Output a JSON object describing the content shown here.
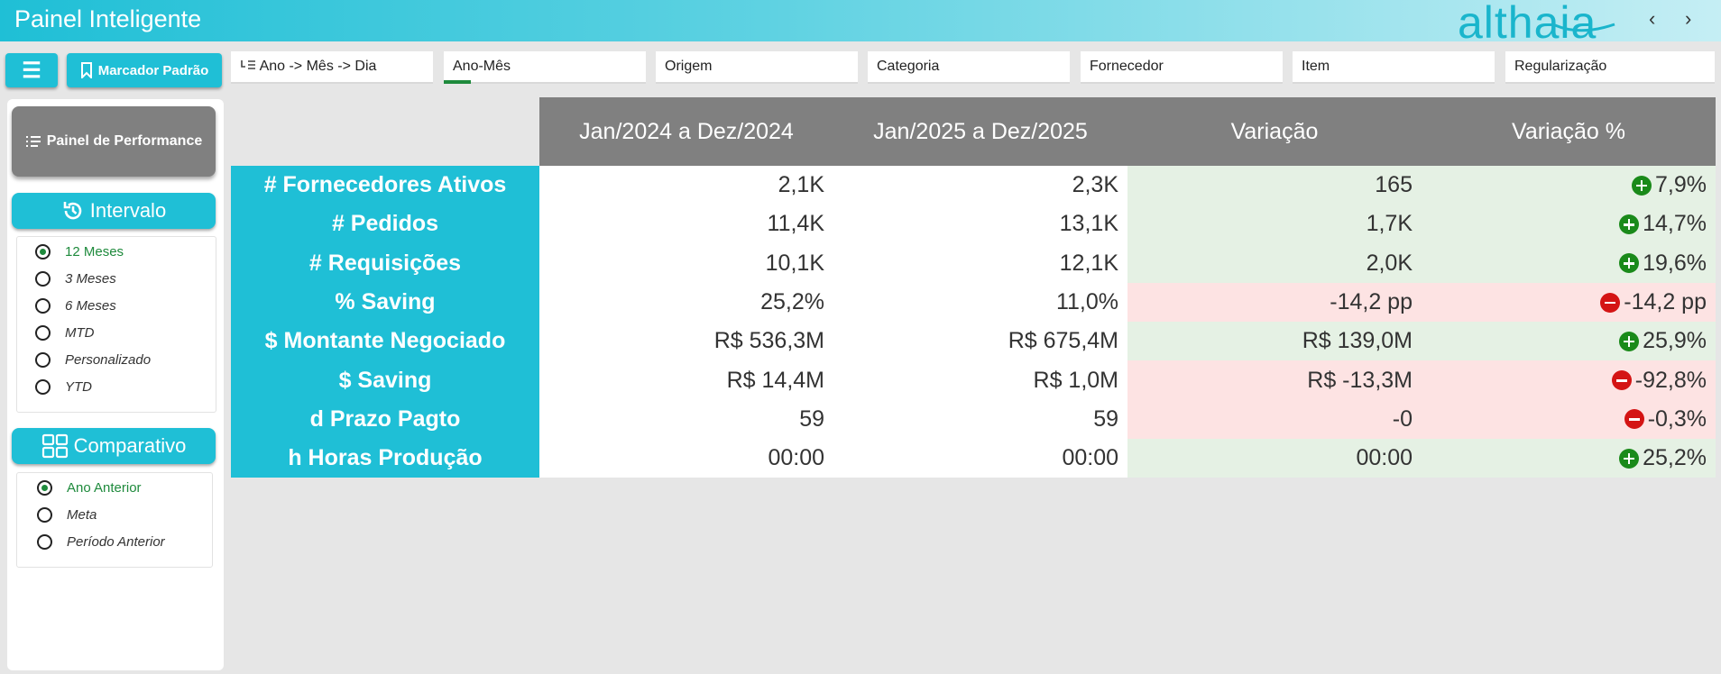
{
  "header": {
    "title": "Painel Inteligente",
    "brand": "althaia",
    "prev": "‹",
    "next": "›"
  },
  "toolbar": {
    "menu_icon": "☰",
    "bookmark_label": "Marcador Padrão",
    "filters": [
      "Ano -> Mês -> Dia",
      "Ano-Mês",
      "Origem",
      "Categoria",
      "Fornecedor",
      "Item",
      "Regularização"
    ]
  },
  "sidebar": {
    "performance_label": "Painel de Performance",
    "intervalo": {
      "title": "Intervalo",
      "options": [
        "12 Meses",
        "3 Meses",
        "6 Meses",
        "MTD",
        "Personalizado",
        "YTD"
      ],
      "selected": "12 Meses"
    },
    "comparativo": {
      "title": "Comparativo",
      "options": [
        "Ano Anterior",
        "Meta",
        "Período Anterior"
      ],
      "selected": "Ano Anterior"
    }
  },
  "table": {
    "headers": [
      "Jan/2024 a Dez/2024",
      "Jan/2025 a Dez/2025",
      "Variação",
      "Variação %"
    ],
    "rows": [
      {
        "label": "# Fornecedores Ativos",
        "a": "2,1K",
        "b": "2,3K",
        "var": "165",
        "pct": "7,9%",
        "status": "positive"
      },
      {
        "label": "# Pedidos",
        "a": "11,4K",
        "b": "13,1K",
        "var": "1,7K",
        "pct": "14,7%",
        "status": "positive"
      },
      {
        "label": "# Requisições",
        "a": "10,1K",
        "b": "12,1K",
        "var": "2,0K",
        "pct": "19,6%",
        "status": "positive"
      },
      {
        "label": "% Saving",
        "a": "25,2%",
        "b": "11,0%",
        "var": "-14,2 pp",
        "pct": "-14,2 pp",
        "status": "negative"
      },
      {
        "label": "$ Montante Negociado",
        "a": "R$ 536,3M",
        "b": "R$ 675,4M",
        "var": "R$ 139,0M",
        "pct": "25,9%",
        "status": "positive"
      },
      {
        "label": "$ Saving",
        "a": "R$ 14,4M",
        "b": "R$ 1,0M",
        "var": "R$ -13,3M",
        "pct": "-92,8%",
        "status": "negative"
      },
      {
        "label": "d Prazo Pagto",
        "a": "59",
        "b": "59",
        "var": "-0",
        "pct": "-0,3%",
        "status": "negative"
      },
      {
        "label": "h Horas Produção",
        "a": "00:00",
        "b": "00:00",
        "var": "00:00",
        "pct": "25,2%",
        "status": "positive"
      }
    ]
  },
  "colors": {
    "accent": "#1fbfd6",
    "positive": "#1a8a1a",
    "negative": "#d41414",
    "header_gray": "#808080"
  }
}
